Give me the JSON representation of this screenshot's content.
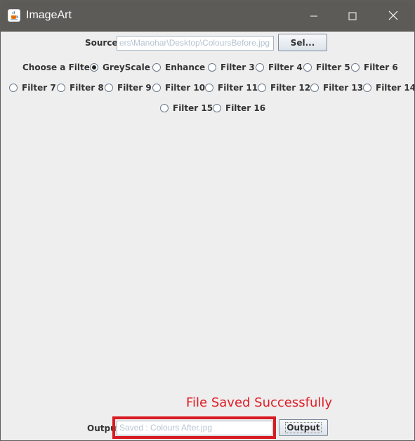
{
  "window": {
    "title": "ImageArt",
    "app_icon": "java-cup-icon",
    "controls": {
      "minimize_icon": "minimize-icon",
      "maximize_icon": "maximize-icon",
      "close_icon": "close-icon"
    }
  },
  "source": {
    "label": "Source",
    "value": "ers\\Manohar\\Desktop\\ColoursBefore.jpg",
    "button_label": "Sel..."
  },
  "filters": {
    "label": "Choose a Filter",
    "selected": "GreyScale",
    "options": [
      "GreyScale",
      "Enhance",
      "Filter 3",
      "Filter 4",
      "Filter 5",
      "Filter 6",
      "Filter 7",
      "Filter 8",
      "Filter 9",
      "Filter 10",
      "Filter 11",
      "Filter 12",
      "Filter 13",
      "Filter 14",
      "Filter 15",
      "Filter 16"
    ]
  },
  "output": {
    "label": "Output",
    "value": "Saved : Colours After.jpg",
    "button_label": "Output"
  },
  "status": {
    "message": "File Saved Successfully",
    "color": "#e01b24"
  },
  "colors": {
    "titlebar": "#5d5b58",
    "window_bg": "#eeeeee",
    "annotation_red": "#d81b22"
  }
}
